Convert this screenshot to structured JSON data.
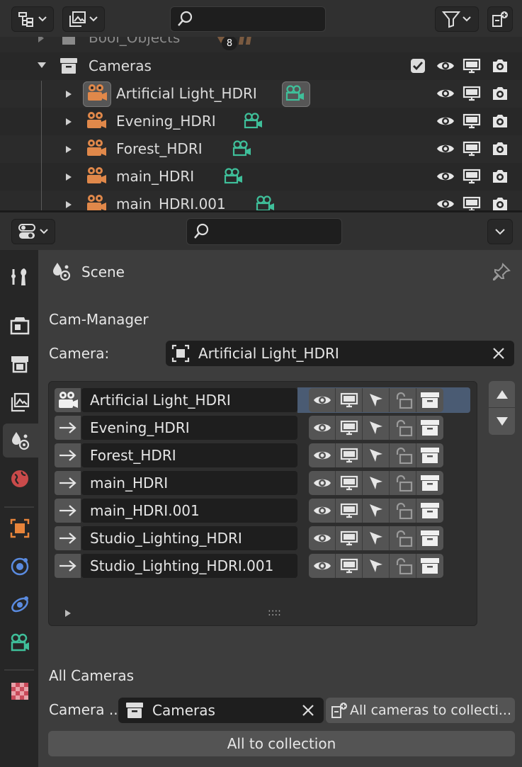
{
  "outliner": {
    "rows": [
      {
        "label": "Bool_Objects",
        "badge": "8"
      },
      {
        "label": "Cameras"
      },
      {
        "label": "Artificial Light_HDRI"
      },
      {
        "label": "Evening_HDRI"
      },
      {
        "label": "Forest_HDRI"
      },
      {
        "label": "main_HDRI"
      },
      {
        "label": "main_HDRI.001"
      }
    ]
  },
  "properties": {
    "context_label": "Scene",
    "panel_title": "Cam-Manager",
    "camera_label": "Camera:",
    "camera_value": "Artificial Light_HDRI",
    "list_items": [
      "Artificial Light_HDRI",
      "Evening_HDRI",
      "Forest_HDRI",
      "main_HDRI",
      "main_HDRI.001",
      "Studio_Lighting_HDRI",
      "Studio_Lighting_HDRI.001"
    ],
    "grip": "::::",
    "all_cameras_title": "All Cameras",
    "collection_label": "Camera ...",
    "collection_value": "Cameras",
    "all_cameras_button": "All cameras to collecti...",
    "all_to_collection_button": "All to collection"
  },
  "colors": {
    "camera_orange": "#e0884a",
    "camera_green": "#3fbf9a",
    "highlight": "#4a5b73"
  }
}
